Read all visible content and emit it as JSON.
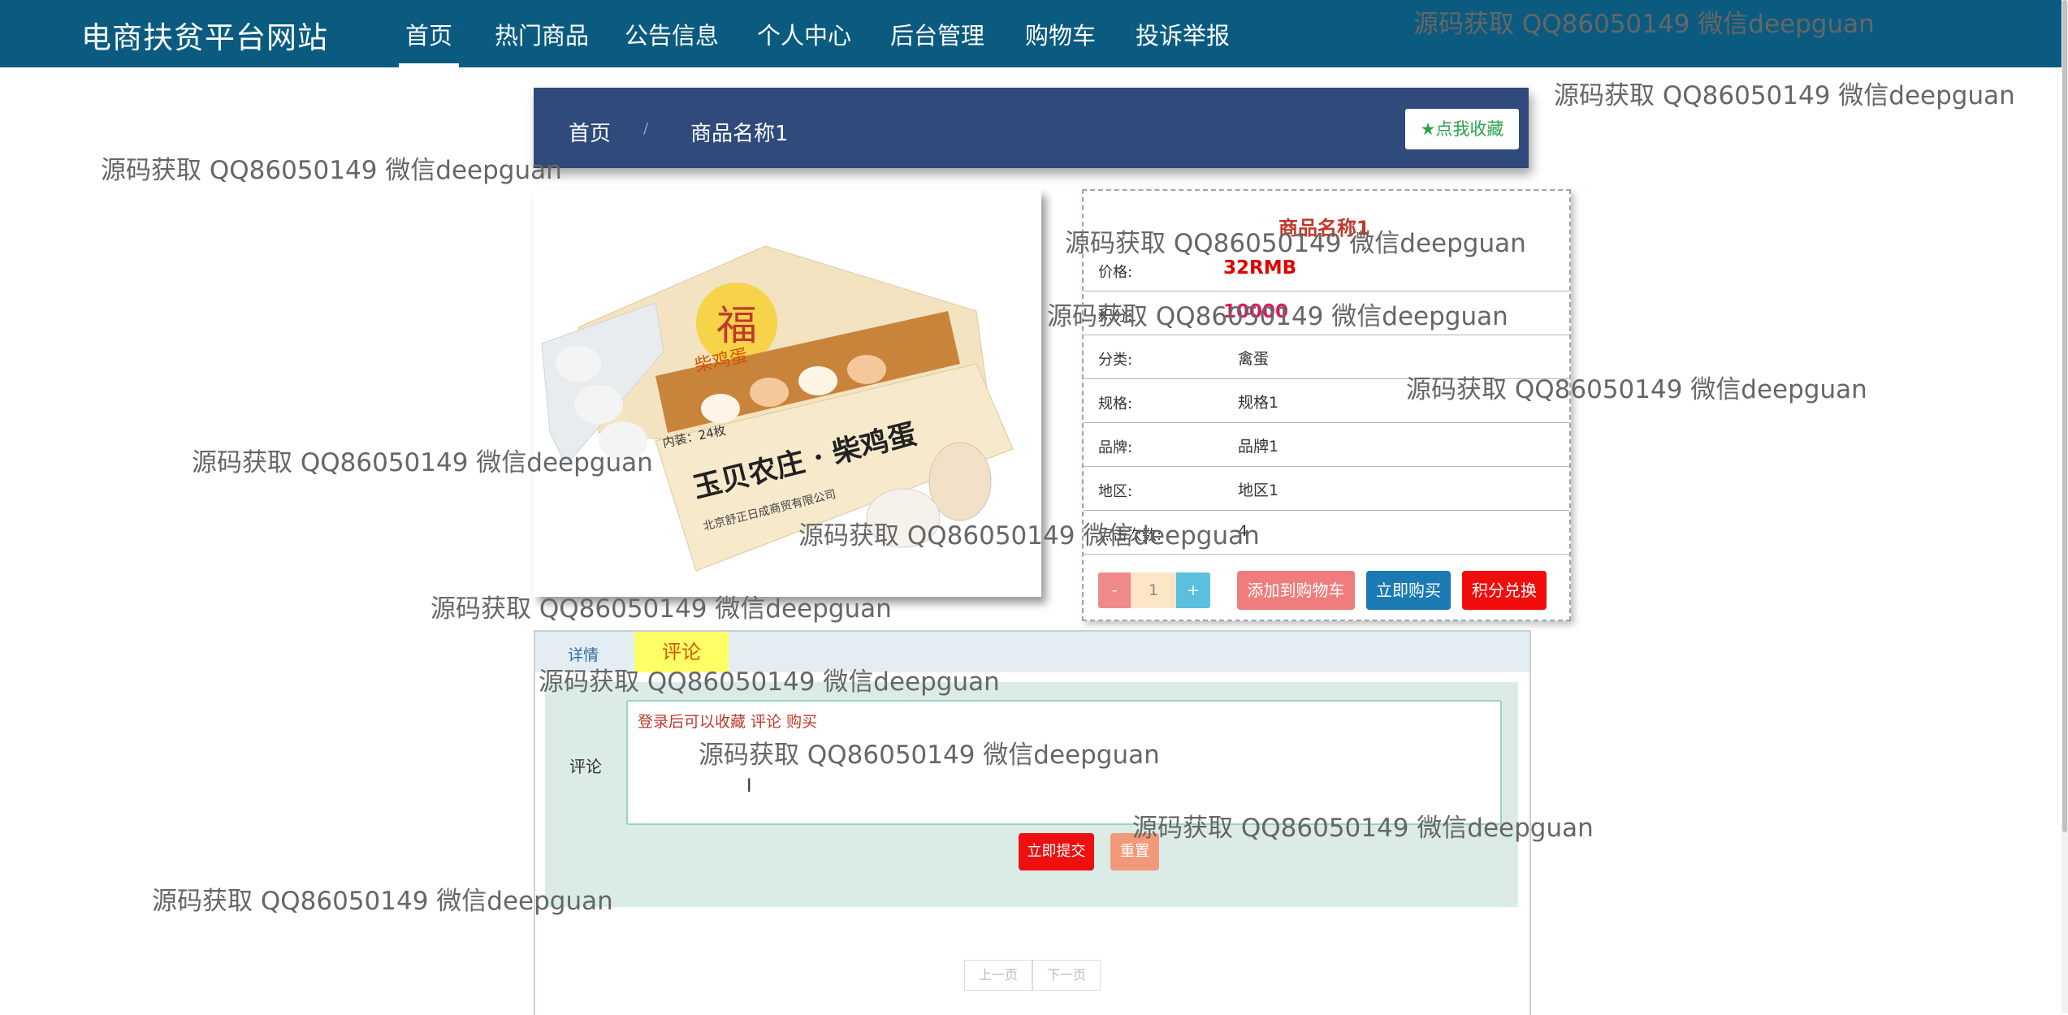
{
  "nav": {
    "brand": "电商扶贫平台网站",
    "items": [
      "首页",
      "热门商品",
      "公告信息",
      "个人中心",
      "后台管理",
      "购物车",
      "投诉举报"
    ]
  },
  "breadcrumb": {
    "home": "首页",
    "separator": "/",
    "current": "商品名称1",
    "favorite_label": "点我收藏"
  },
  "product": {
    "name": "商品名称1",
    "price_label": "价格:",
    "price": "32RMB",
    "points_label": "积分:",
    "points": "10000",
    "category_label": "分类:",
    "category": "禽蛋",
    "spec_label": "规格:",
    "spec": "规格1",
    "brand_label": "品牌:",
    "brand": "品牌1",
    "region_label": "地区:",
    "region": "地区1",
    "clicks_label": "点击次数:",
    "clicks": "4",
    "image_text": {
      "logo": "福",
      "name_small": "柴鸡蛋",
      "name_big": "玉贝农庄 · 柴鸡蛋",
      "count": "内装：24枚",
      "company": "北京舒正日成商贸有限公司"
    }
  },
  "purchase": {
    "minus": "-",
    "quantity": "1",
    "plus": "+",
    "add_to_cart": "添加到购物车",
    "buy_now": "立即购买",
    "points_exchange": "积分兑换"
  },
  "tabs": {
    "detail": "详情",
    "comment": "评论"
  },
  "comment": {
    "label": "评论",
    "placeholder": "登录后可以收藏 评论  购买",
    "cursor": "I",
    "submit": "立即提交",
    "reset": "重置"
  },
  "pager": {
    "prev": "上一页",
    "next": "下一页"
  },
  "watermark": "源码获取 QQ86050149 微信deepguan"
}
